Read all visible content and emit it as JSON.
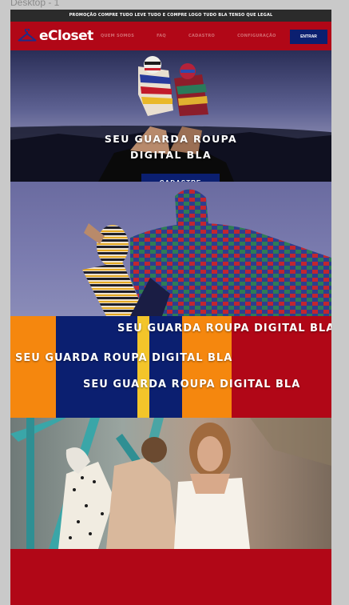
{
  "frame_label": "Desktop - 1",
  "promo_text": "PROMOÇÃO COMPRE TUDO LEVE TUDO E COMPRE LOGO TUDO BLA TENSO QUE LEGAL",
  "brand": {
    "name": "eCloset",
    "icon": "hanger-icon"
  },
  "nav": {
    "links": [
      "QUEM SOMOS",
      "FAQ",
      "CADASTRO",
      "CONFIGURAÇÃO"
    ],
    "login_label": "ENTRAR"
  },
  "hero": {
    "title_line1": "SEU GUARDA ROUPA",
    "title_line2": "DIGITAL BLA",
    "cta_label": "CADASTRE"
  },
  "banner": {
    "lines": [
      "SEU GUARDA ROUPA DIGITAL BLA",
      "SEU GUARDA ROUPA DIGITAL BLA",
      "SEU GUARDA ROUPA DIGITAL BLA"
    ]
  },
  "colors": {
    "red": "#b10717",
    "navy": "#0b1f70",
    "orange": "#f5870e",
    "yellow": "#f3c52a",
    "promo_bg": "#2b2b2b"
  }
}
